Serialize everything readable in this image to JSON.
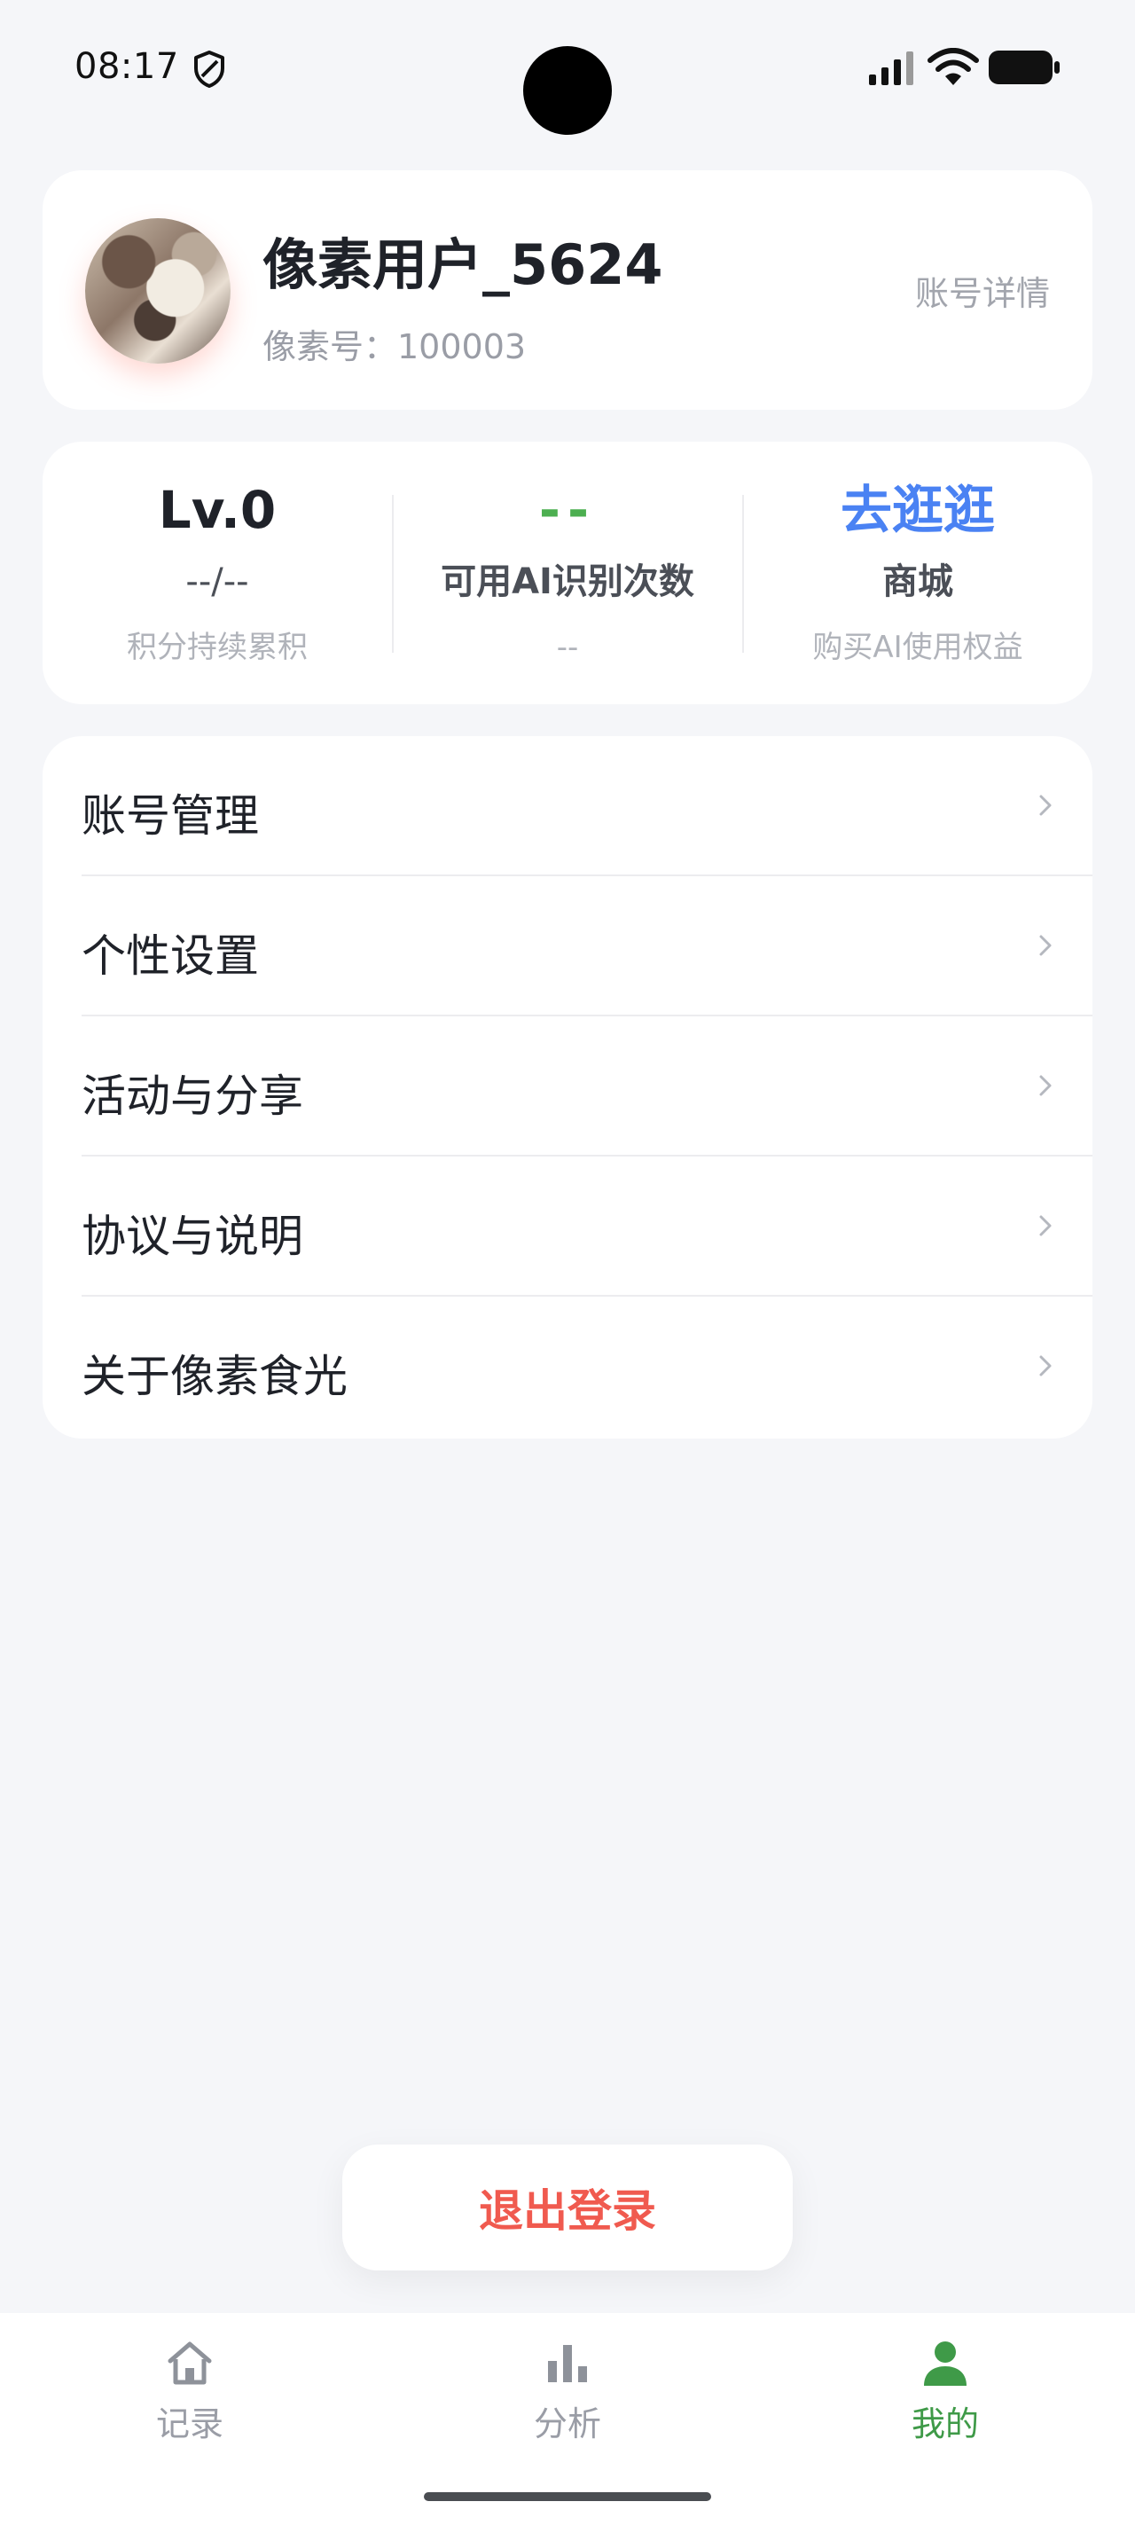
{
  "status_bar": {
    "time": "08:17"
  },
  "profile": {
    "username": "像素用户_5624",
    "id_text": "像素号：100003",
    "detail_link": "账号详情"
  },
  "stats": {
    "level": {
      "value": "Lv.0",
      "label": "--/--",
      "sub": "积分持续累积"
    },
    "ai_count": {
      "value": "--",
      "label": "可用AI识别次数",
      "sub": "--"
    },
    "shop": {
      "value": "去逛逛",
      "label": "商城",
      "sub": "购买AI使用权益"
    }
  },
  "menu": {
    "items": [
      {
        "label": "账号管理"
      },
      {
        "label": "个性设置"
      },
      {
        "label": "活动与分享"
      },
      {
        "label": "协议与说明"
      },
      {
        "label": "关于像素食光"
      }
    ]
  },
  "logout": {
    "label": "退出登录"
  },
  "tab_bar": {
    "tabs": [
      {
        "label": "记录",
        "icon": "home-icon",
        "active": false
      },
      {
        "label": "分析",
        "icon": "bar-chart-icon",
        "active": false
      },
      {
        "label": "我的",
        "icon": "person-icon",
        "active": true
      }
    ]
  },
  "colors": {
    "accent_green": "#4caf50",
    "link_blue": "#4a82f3",
    "logout_red": "#f05a4f",
    "background": "#f5f6f9"
  }
}
